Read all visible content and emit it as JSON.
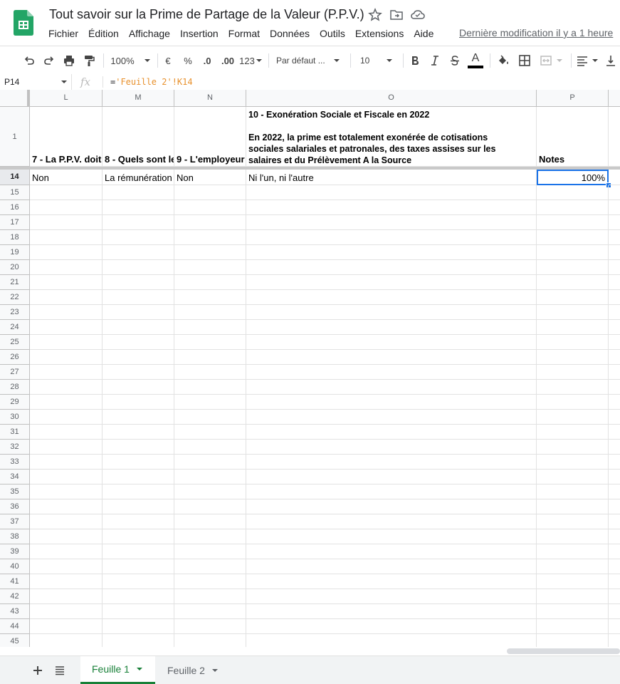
{
  "doc": {
    "title": "Tout savoir sur la Prime de Partage de la Valeur (P.P.V.)",
    "last_edit": "Dernière modification il y a 1 heure"
  },
  "menu": [
    "Fichier",
    "Édition",
    "Affichage",
    "Insertion",
    "Format",
    "Données",
    "Outils",
    "Extensions",
    "Aide"
  ],
  "toolbar": {
    "zoom": "100%",
    "currency": "€",
    "percent": "%",
    "dec_decrease": ".0",
    "dec_increase": ".00",
    "number_format": "123",
    "font": "Par défaut ...",
    "font_size": "10",
    "text_color": "A",
    "icons": [
      "undo-icon",
      "redo-icon",
      "print-icon",
      "paint-format-icon",
      "bold-icon",
      "italic-icon",
      "strikethrough-icon",
      "text-color-icon",
      "fill-color-icon",
      "borders-icon",
      "merge-icon",
      "align-icon",
      "valign-icon"
    ]
  },
  "formula_bar": {
    "cell_ref": "P14",
    "fx": "fx",
    "formula_eq": "=",
    "formula_ref": "'Feuille 2'!K14"
  },
  "columns": [
    "L",
    "M",
    "N",
    "O",
    "P"
  ],
  "header_row": {
    "number": "1",
    "L": "7 - La P.P.V. doit",
    "M": "8 - Quels sont le",
    "N": "9 - L'employeur",
    "O_line1": "10 - Exonération Sociale et Fiscale en 2022",
    "O_line2": "En 2022, la prime est totalement exonérée de cotisations",
    "O_line3": "sociales salariales et patronales, des taxes assises sur les",
    "O_line4": "salaires et du Prélèvement A la Source",
    "P": "Notes"
  },
  "data_row": {
    "number": "14",
    "L": "Non",
    "M": "La rémunération",
    "N": "Non",
    "O": "Ni l'un, ni l'autre",
    "P": "100%"
  },
  "empty_rows": [
    "15",
    "16",
    "17",
    "18",
    "19",
    "20",
    "21",
    "22",
    "23",
    "24",
    "25",
    "26",
    "27",
    "28",
    "29",
    "30",
    "31",
    "32",
    "33",
    "34",
    "35",
    "36",
    "37",
    "38",
    "39",
    "40",
    "41",
    "42",
    "43",
    "44",
    "45"
  ],
  "sheets": [
    {
      "name": "Feuille 1",
      "active": true
    },
    {
      "name": "Feuille 2",
      "active": false
    }
  ],
  "colors": {
    "accent_green": "#188038",
    "selection_blue": "#1a73e8",
    "formula_ref": "#e8912d"
  }
}
